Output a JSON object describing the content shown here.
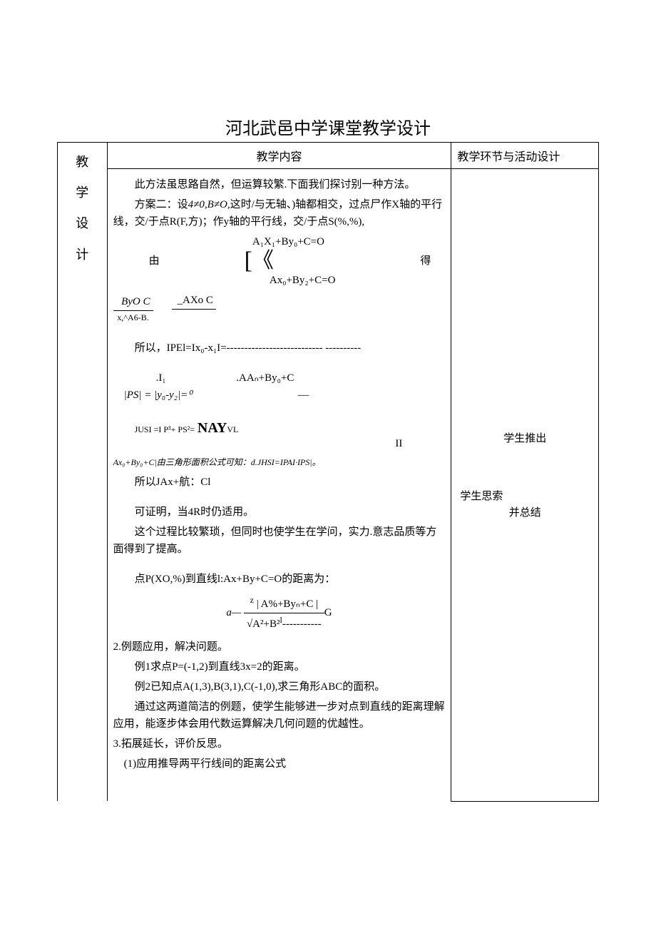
{
  "title": "河北武邑中学课堂教学设计",
  "headers": {
    "mid": "教学内容",
    "right": "教学环节与活动设计"
  },
  "left_col": {
    "l1": "教",
    "l2": "学",
    "l3": "设",
    "l4": "计"
  },
  "body": {
    "p1": "此方法虽思路自然，但运算较繁.下面我们探讨别一种方法。",
    "p2_pre": "方案二：设",
    "p2_mid": "4≠0,B≠O,",
    "p2_cont": "这时/与无轴、)轴都相交，过点尸作X轴的平行线，交/于点R(F,方)；作y轴的平行线，交/于点S(%,%),",
    "p3_you": "由",
    "p3_de": "得",
    "eq_top": "A₁X₁+By₀+C=O",
    "eq_bot": "Ax₀+By₂+C=O",
    "frac1_num": "ByO C",
    "frac1_den": "x,^A6-B.",
    "frac2_num": "_AXo C",
    "p4": "所以，IPEl=Ix₀-x₁I=--------------------------- ----------",
    "p5_a": ".I₁",
    "p5_b": ".AAₙ+By₀+C",
    "p5_c": "|PS| = |y₀-y₂|=⁰",
    "p5_d": "—",
    "p6_a": "JUSI   =I  P³+  PS²=",
    "p6_b": "NAY",
    "p6_c": "VL",
    "p6_d": "II",
    "p7": "Ax₀+By₀+C|由三角形面积公式可知：d.JHSI=IPAI·IPS|。",
    "p8": "所以JAx+航：Cl",
    "p9": "可证明，当4R时仍适用。",
    "p10": "这个过程比较繁琐，但同时也使学生在学问，实力.意志品质等方面得到了提高。",
    "p11": "点P(XO,%)到直线l:Ax+By+C=O的距离为：",
    "main_frac_left": "a—",
    "main_frac_num": "| A%+Byₙ+C |",
    "main_frac_den_sqrt": "√A²+B²",
    "main_frac_dash": "-----------",
    "main_frac_right": "G",
    "main_frac_small": "z",
    "main_frac_small2": "l",
    "p12": "2.例题应用，解决问题。",
    "p13": "例1求点P=(-1,2)到直线3x=2的距离。",
    "p14": "例2已知点A(1,3),B(3,1),C(-1,0),求三角形ABC的面积。",
    "p15": "通过这两道简洁的例题，使学生能够进一步对点到直线的距离理解应用，能逐步体会用代数运算解决几何问题的优越性。",
    "p16": "3.拓展延长，评价反思。",
    "p17": "(1)应用推导两平行线间的距离公式"
  },
  "right": {
    "r1": "学生推出",
    "r2": "学生思索",
    "r3": "并总结"
  }
}
